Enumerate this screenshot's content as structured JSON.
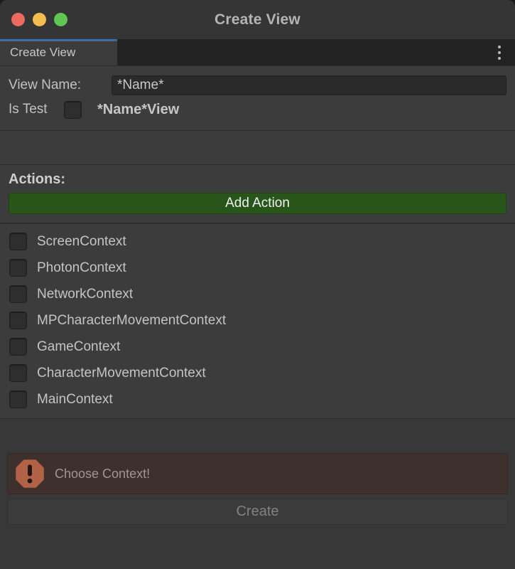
{
  "window": {
    "title": "Create View",
    "traffic_lights": [
      {
        "name": "close",
        "color": "#ec6a5f"
      },
      {
        "name": "minimize",
        "color": "#f4bd4f"
      },
      {
        "name": "maximize",
        "color": "#61c554"
      }
    ]
  },
  "tabs": {
    "active_tab_label": "Create View",
    "menu_icon": "kebab-menu-icon",
    "accent_color": "#3b6ea5"
  },
  "name_section": {
    "view_name_label": "View Name:",
    "view_name_value": "*Name*",
    "view_name_placeholder": "*Name*",
    "is_test_label": "Is Test",
    "is_test_checked": false,
    "preview_name": "*Name*View"
  },
  "actions_section": {
    "heading": "Actions:",
    "add_action_label": "Add Action",
    "add_action_color": "#27551a"
  },
  "contexts": [
    {
      "label": "ScreenContext",
      "checked": false
    },
    {
      "label": "PhotonContext",
      "checked": false
    },
    {
      "label": "NetworkContext",
      "checked": false
    },
    {
      "label": "MPCharacterMovementContext",
      "checked": false
    },
    {
      "label": "GameContext",
      "checked": false
    },
    {
      "label": "CharacterMovementContext",
      "checked": false
    },
    {
      "label": "MainContext",
      "checked": false
    }
  ],
  "warning": {
    "icon": "error-octagon-icon",
    "message": "Choose Context!",
    "icon_color": "#b26246",
    "background_color": "#3e302d"
  },
  "footer": {
    "create_label": "Create",
    "create_enabled": false
  }
}
